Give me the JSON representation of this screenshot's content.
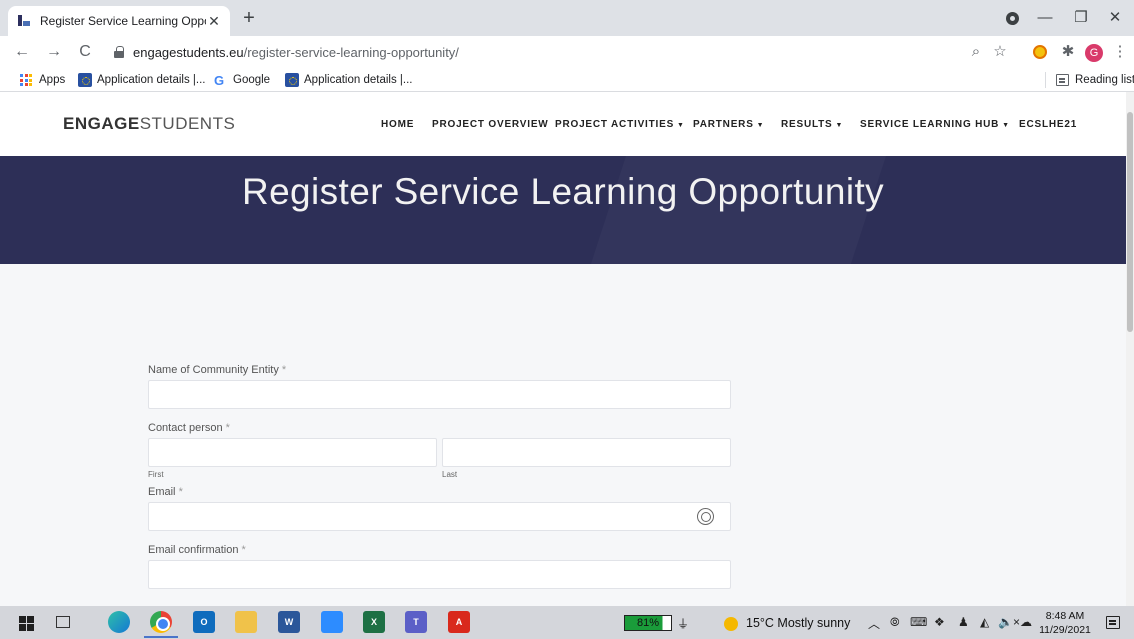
{
  "browser": {
    "tab_title": "Register Service Learning Opport",
    "tab_close": "✕",
    "new_tab": "+",
    "window_minimize": "—",
    "window_restore": "❐",
    "window_close": "✕",
    "back": "←",
    "forward": "→",
    "reload": "C",
    "url_host": "engagestudents.eu",
    "url_path": "/register-service-learning-opportunity/",
    "zoom_icon": "⌕",
    "star_icon": "☆",
    "puzzle_icon": "✱",
    "avatar_letter": "G",
    "menu_icon": "⋮"
  },
  "bookmarks": {
    "apps": "Apps",
    "items": [
      "Application details |...",
      "Google",
      "Application details |..."
    ],
    "reading_list": "Reading list"
  },
  "site": {
    "logo_bold": "ENGAGE",
    "logo_light": "STUDENTS",
    "nav": [
      {
        "label": "HOME",
        "caret": ""
      },
      {
        "label": "PROJECT OVERVIEW",
        "caret": ""
      },
      {
        "label": "PROJECT ACTIVITIES",
        "caret": "▼"
      },
      {
        "label": "PARTNERS",
        "caret": "▼"
      },
      {
        "label": "RESULTS",
        "caret": "▼"
      },
      {
        "label": "SERVICE LEARNING HUB",
        "caret": "▼"
      },
      {
        "label": "ECSLHE21",
        "caret": ""
      }
    ],
    "hero_title": "Register Service Learning Opportunity"
  },
  "form": {
    "entity_label": "Name of Community Entity",
    "contact_label": "Contact person",
    "first_sublabel": "First",
    "last_sublabel": "Last",
    "email_label": "Email",
    "email_confirm_label": "Email confirmation",
    "required_mark": "*"
  },
  "taskbar": {
    "battery": "81%",
    "plug": "⏚",
    "weather": "15°C  Mostly sunny",
    "tray_chevron": "︿",
    "volume": "🔈×",
    "time": "8:48 AM",
    "date": "11/29/2021"
  }
}
